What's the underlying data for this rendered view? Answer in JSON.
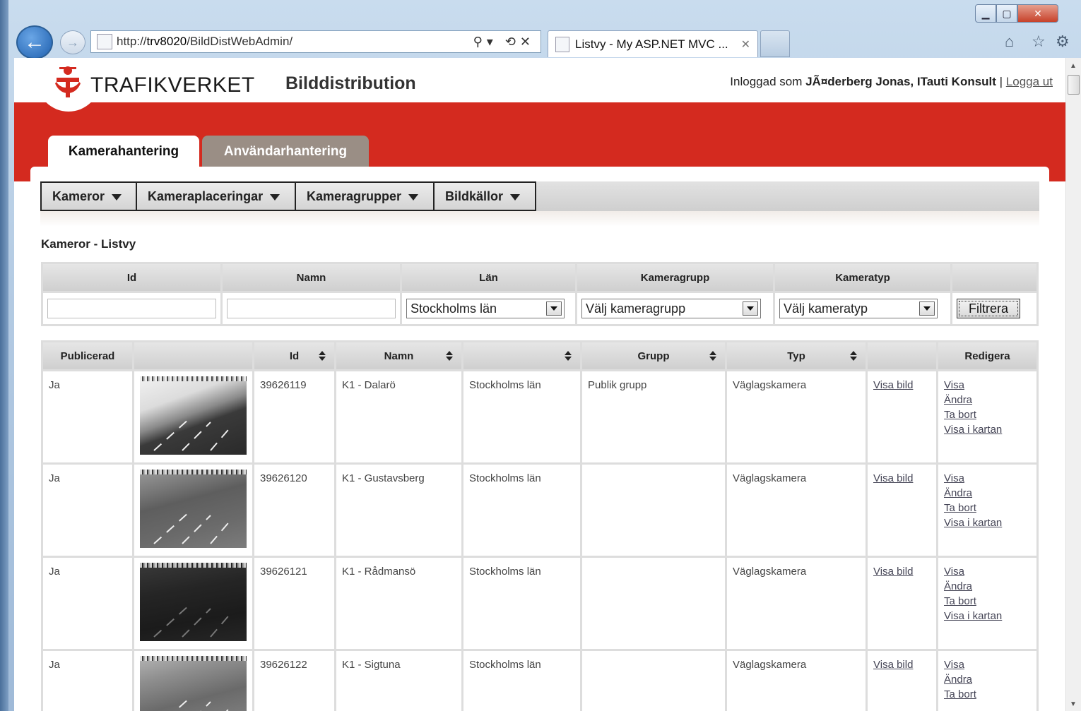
{
  "browser": {
    "url_prefix": "http://",
    "url_host": "trv8020",
    "url_path": "/BildDistWebAdmin/",
    "tab_title": "Listvy - My ASP.NET MVC ...",
    "tab_close": "✕"
  },
  "header": {
    "logo_text": "TRAFIKVERKET",
    "app_title": "Bilddistribution",
    "login_prefix": "Inloggad som ",
    "login_user": "JÃ¤derberg Jonas, ITauti Konsult",
    "login_sep": " | ",
    "logout": "Logga ut"
  },
  "main_tabs": [
    {
      "label": "Kamerahantering",
      "active": true
    },
    {
      "label": "Användarhantering",
      "active": false
    }
  ],
  "menu": [
    {
      "label": "Kameror"
    },
    {
      "label": "Kameraplaceringar"
    },
    {
      "label": "Kameragrupper"
    },
    {
      "label": "Bildkällor"
    }
  ],
  "section_title": "Kameror - Listvy",
  "filter": {
    "headers": [
      "Id",
      "Namn",
      "Län",
      "Kameragrupp",
      "Kameratyp",
      ""
    ],
    "id_value": "",
    "namn_value": "",
    "lan_selected": "Stockholms län",
    "grupp_selected": "Välj kameragrupp",
    "typ_selected": "Välj kameratyp",
    "button": "Filtrera"
  },
  "grid": {
    "headers": [
      "Publicerad",
      "",
      "Id",
      "Namn",
      "",
      "Grupp",
      "Typ",
      "",
      "Redigera"
    ],
    "rows": [
      {
        "publicerad": "Ja",
        "id": "39626119",
        "namn": "K1 - Dalarö",
        "lan": "Stockholms län",
        "grupp": "Publik grupp",
        "typ": "Väglagskamera",
        "visa_bild": "Visa bild",
        "actions": [
          "Visa",
          "Ändra",
          "Ta bort",
          "Visa i kartan"
        ]
      },
      {
        "publicerad": "Ja",
        "id": "39626120",
        "namn": "K1 - Gustavsberg",
        "lan": "Stockholms län",
        "grupp": "",
        "typ": "Väglagskamera",
        "visa_bild": "Visa bild",
        "actions": [
          "Visa",
          "Ändra",
          "Ta bort",
          "Visa i kartan"
        ]
      },
      {
        "publicerad": "Ja",
        "id": "39626121",
        "namn": "K1 - Rådmansö",
        "lan": "Stockholms län",
        "grupp": "",
        "typ": "Väglagskamera",
        "visa_bild": "Visa bild",
        "actions": [
          "Visa",
          "Ändra",
          "Ta bort",
          "Visa i kartan"
        ]
      },
      {
        "publicerad": "Ja",
        "id": "39626122",
        "namn": "K1 - Sigtuna",
        "lan": "Stockholms län",
        "grupp": "",
        "typ": "Väglagskamera",
        "visa_bild": "Visa bild",
        "actions": [
          "Visa",
          "Ändra",
          "Ta bort"
        ]
      }
    ]
  },
  "colors": {
    "brand_red": "#d42a1f",
    "tab_inactive": "#9a8e85"
  }
}
